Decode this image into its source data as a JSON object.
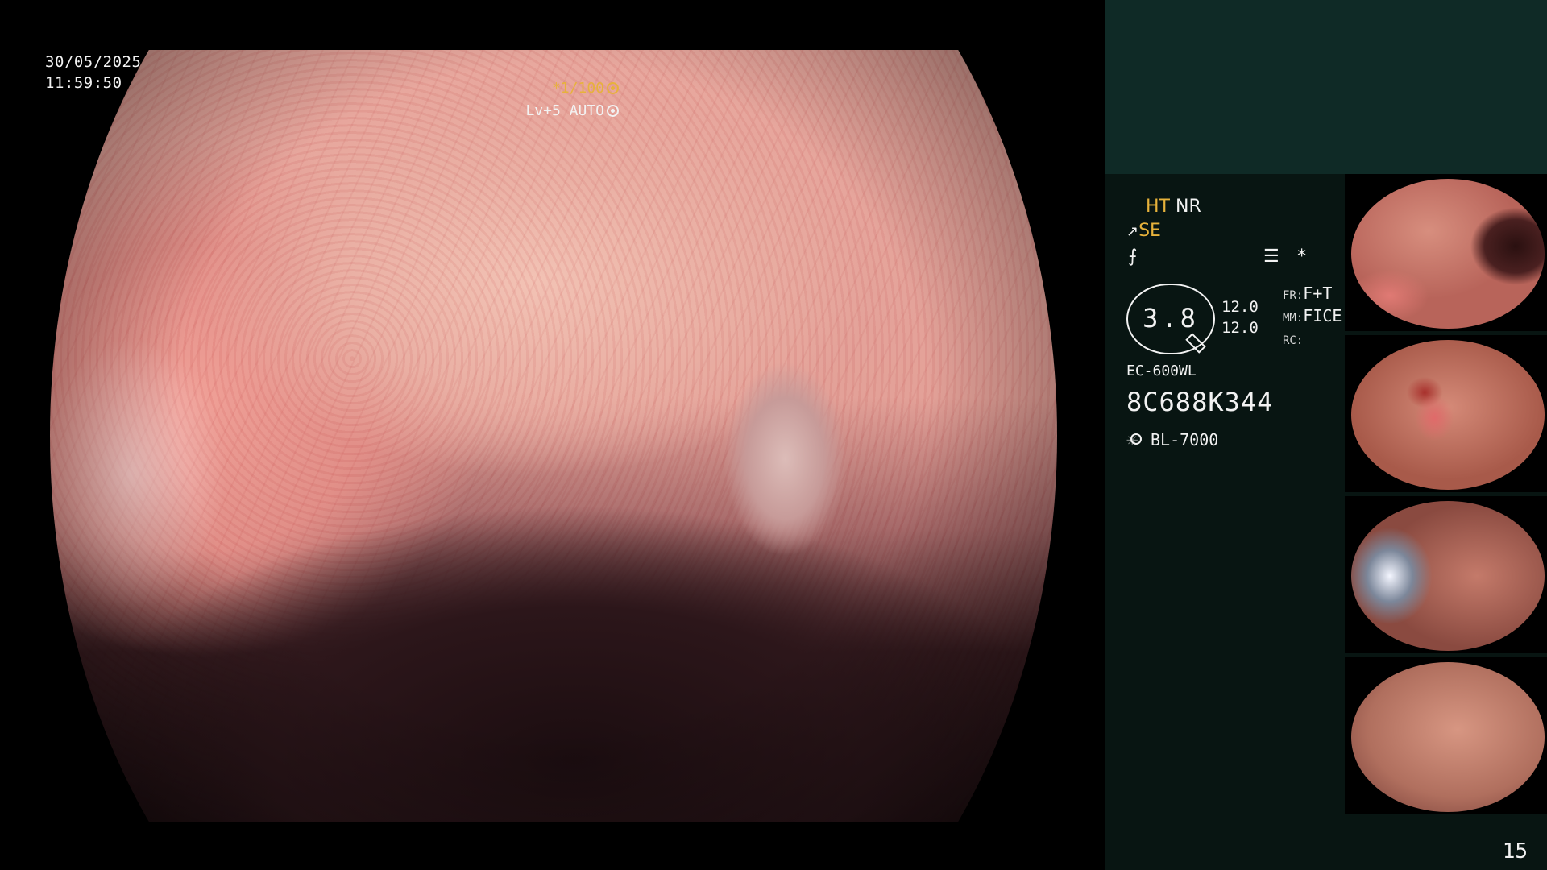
{
  "overlay": {
    "date": "30/05/2025",
    "time": "11:59:50",
    "shutter": "*1/100",
    "level": "Lv+5 AUTO"
  },
  "panel": {
    "ht": "HT",
    "nr": "NR",
    "se": "SE",
    "iris_value": "3.8",
    "contrast_1": "12.0",
    "contrast_2": "12.0",
    "fr_label": "FR:",
    "fr_value": "F+T",
    "mm_label": "MM:",
    "mm_value": "FICE",
    "rc_label": "RC:",
    "rc_value": "",
    "scope_model": "EC-600WL",
    "scope_serial": "8C688K344",
    "light_source": "BL-7000"
  },
  "page_number": "15",
  "colors": {
    "accent_gold": "#e7b23b",
    "panel_bg": "#081512",
    "panel_top_bg": "#0f2a26"
  },
  "icons": [
    "shutter-icon",
    "auto-iris-icon",
    "structure-enhancement-icon",
    "color-enhancement-icon",
    "memo-icon",
    "asterisk-icon",
    "light-source-icon"
  ]
}
